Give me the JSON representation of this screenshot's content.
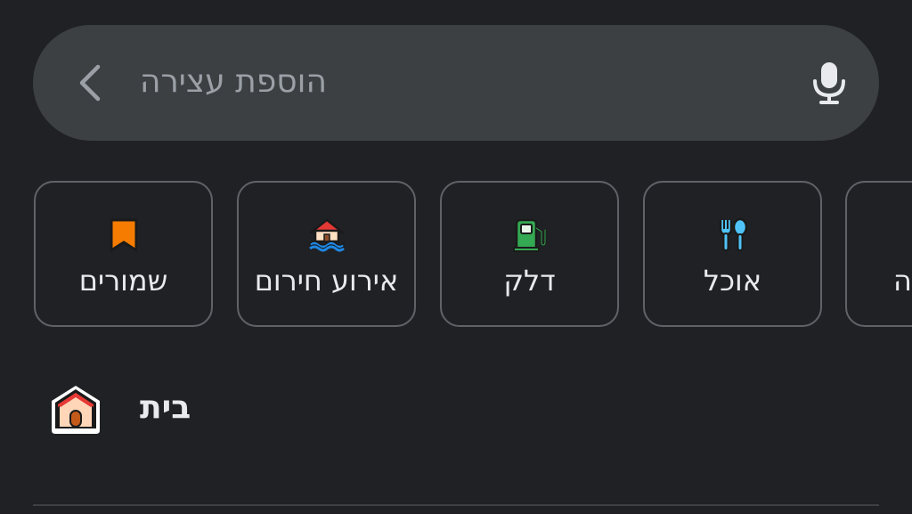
{
  "search": {
    "placeholder": "הוספת עצירה",
    "back_icon": "chevron-left-icon",
    "mic_icon": "microphone-icon"
  },
  "categories": [
    {
      "label": "שמורים",
      "icon": "bookmark-icon",
      "color": "#f57c00"
    },
    {
      "label": "אירוע חירום",
      "icon": "flood-house-icon",
      "color": "#1e88e5"
    },
    {
      "label": "דלק",
      "icon": "gas-station-icon",
      "color": "#34a853"
    },
    {
      "label": "אוכל",
      "icon": "fork-spoon-icon",
      "color": "#4fc3f7"
    },
    {
      "label": "ה"
    }
  ],
  "home": {
    "label": "בית",
    "icon": "home-icon"
  },
  "colors": {
    "background": "#202124",
    "search_bg": "#3c4043",
    "chip_border": "#5f6368",
    "text": "#e8eaed",
    "placeholder": "#9aa0a6"
  }
}
